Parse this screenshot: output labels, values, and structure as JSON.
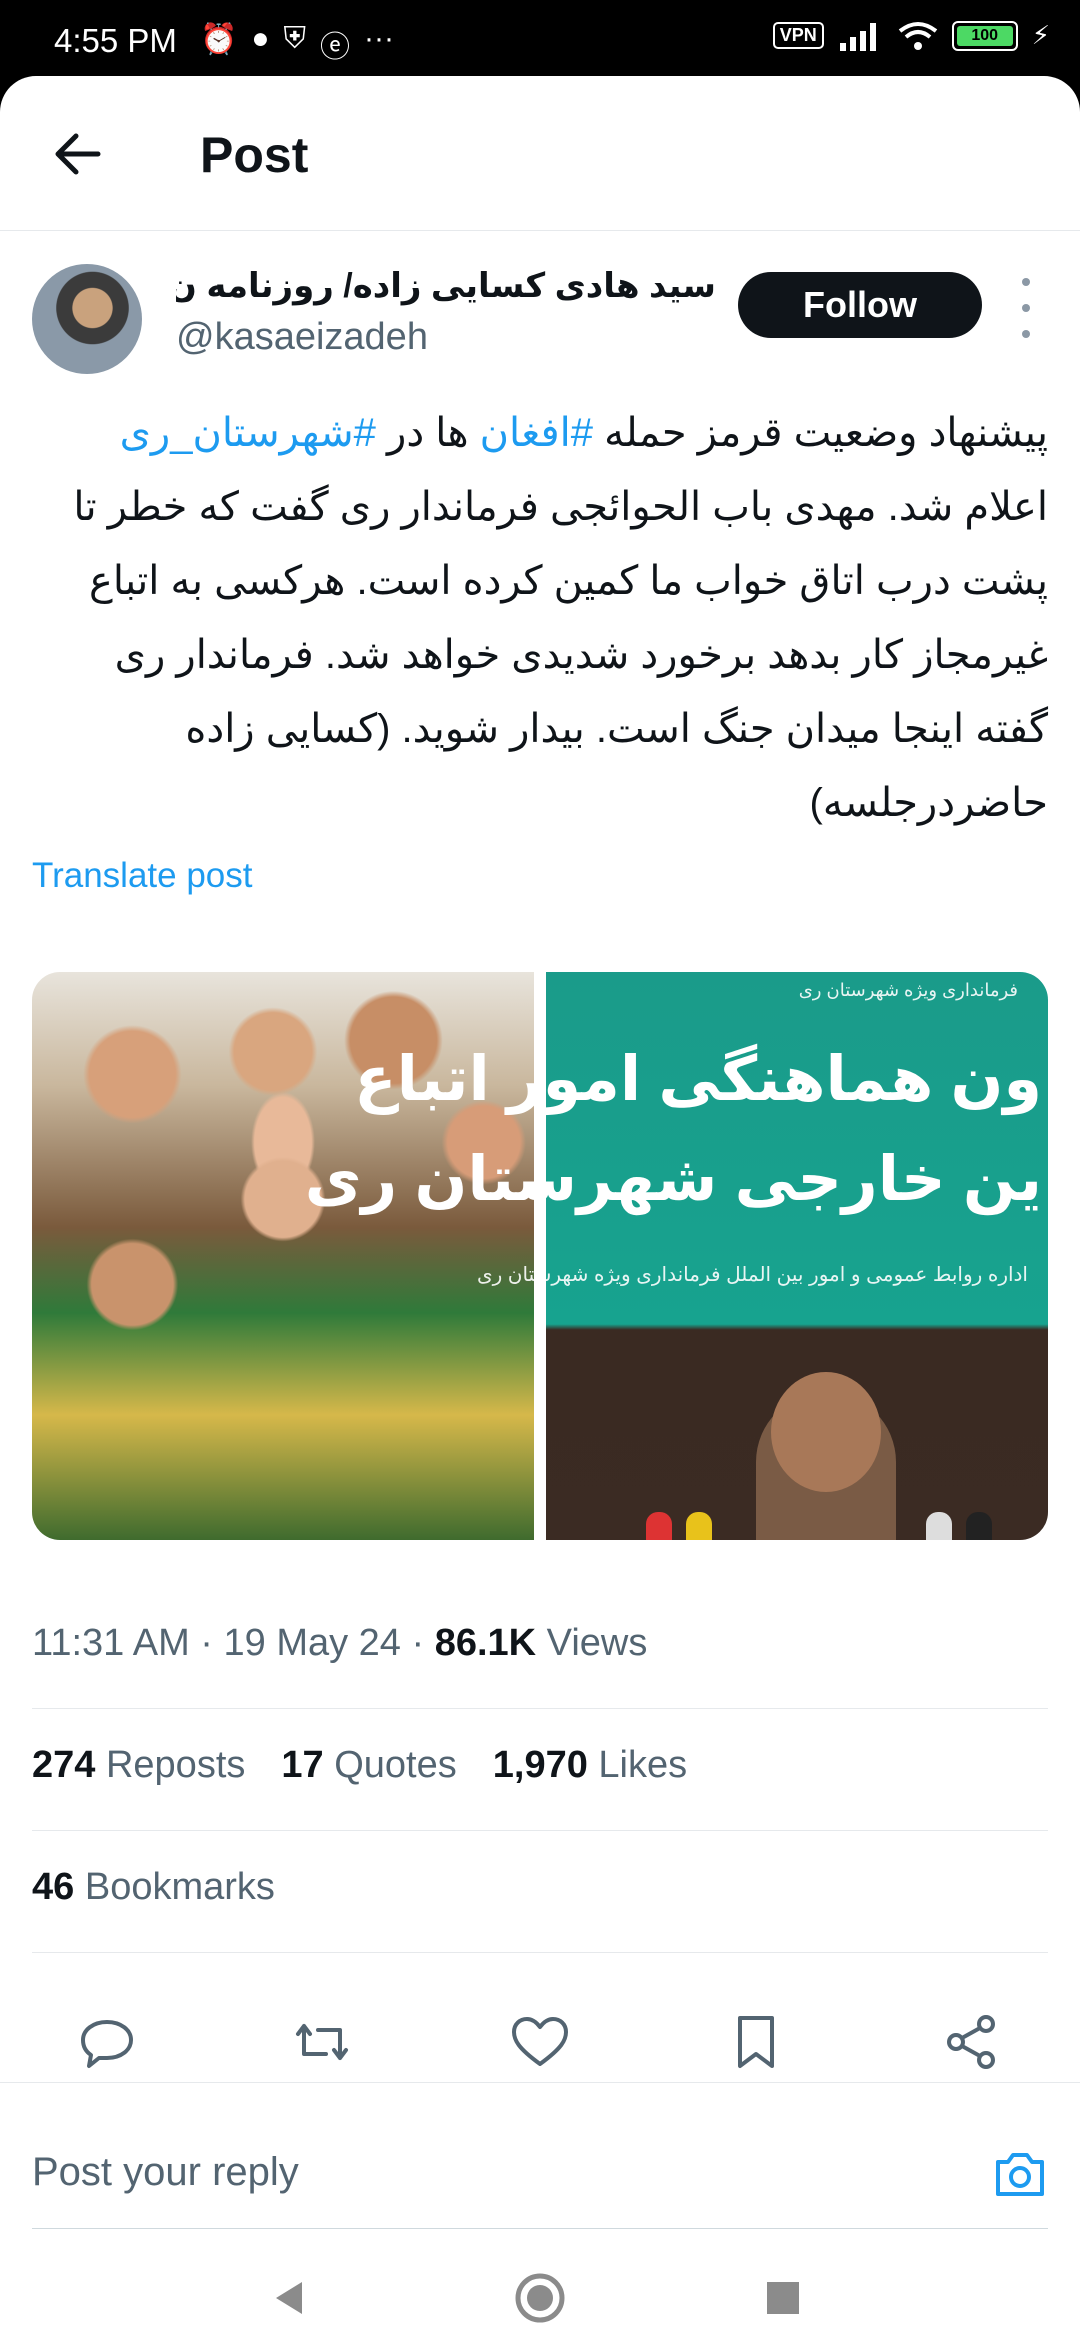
{
  "status_bar": {
    "time": "4:55 PM",
    "vpn": "VPN",
    "battery": "100"
  },
  "header": {
    "title": "Post"
  },
  "author": {
    "name": "سید هادی کسایی زاده/ روزنامه ن...",
    "handle": "@kasaeizadeh",
    "follow_label": "Follow"
  },
  "post": {
    "line1_a": "پیشنهاد وضعیت قرمز حمله ",
    "tag1": "#افغان",
    "line1_b": " ها در ",
    "tag2": "#شهرستان_ری",
    "rest": "اعلام شد. مهدی باب الحوائجی فرماندار ری گفت که خطر تا پشت درب اتاق خواب ما کمین کرده است. هرکسی به اتباع غیرمجاز کار بدهد برخورد شدیدی خواهد شد. فرماندار ری گفته اینجا میدان جنگ است. بیدار شوید. (کسایی زاده حاضردرجلسه)",
    "translate_label": "Translate post"
  },
  "media": {
    "image2_top": "فرمانداری ویژه شهرستان ری",
    "image2_line1": "ون هماهنگی امور اتباع",
    "image2_line2": "ین خارجی شهرستان ری",
    "image2_line3": "اداره روابط عمومی و امور بین الملل فرمانداری ویژه شهرستان ری"
  },
  "meta": {
    "time_date": "11:31 AM · 19 May 24 · ",
    "views_count": "86.1K",
    "views_label": " Views"
  },
  "stats": {
    "reposts_count": "274",
    "reposts_label": "Reposts",
    "quotes_count": "17",
    "quotes_label": "Quotes",
    "likes_count": "1,970",
    "likes_label": "Likes",
    "bookmarks_count": "46",
    "bookmarks_label": "Bookmarks"
  },
  "reply": {
    "placeholder": "Post your reply"
  },
  "icons": {
    "back": "arrow-left-icon",
    "reply": "comment-icon",
    "repost": "repost-icon",
    "like": "heart-icon",
    "bookmark": "bookmark-icon",
    "share": "share-icon",
    "camera": "camera-icon"
  },
  "colors": {
    "accent": "#1d9bf0",
    "text": "#0f1419",
    "muted": "#536471"
  }
}
